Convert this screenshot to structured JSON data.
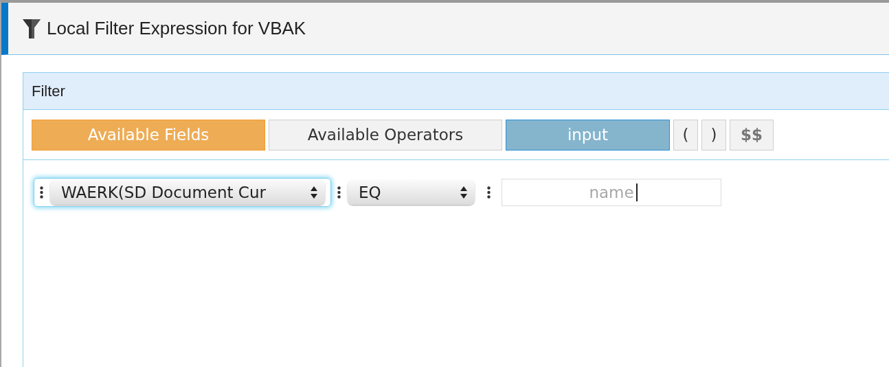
{
  "window": {
    "title": "Local Filter Expression for VBAK"
  },
  "panel": {
    "title": "Filter"
  },
  "toolbar": [
    {
      "label": "Available Fields",
      "kind": "fields"
    },
    {
      "label": "Available Operators",
      "kind": "plain"
    },
    {
      "label": "input",
      "kind": "input"
    },
    {
      "label": "(",
      "kind": "small"
    },
    {
      "label": ")",
      "kind": "small"
    },
    {
      "label": "$$",
      "kind": "macro"
    }
  ],
  "expression": [
    {
      "kind": "select",
      "value": "WAERK(SD Document Cur",
      "focused": true
    },
    {
      "kind": "select",
      "value": "EQ",
      "focused": false
    },
    {
      "kind": "input",
      "placeholder": "name",
      "focused": true
    }
  ]
}
